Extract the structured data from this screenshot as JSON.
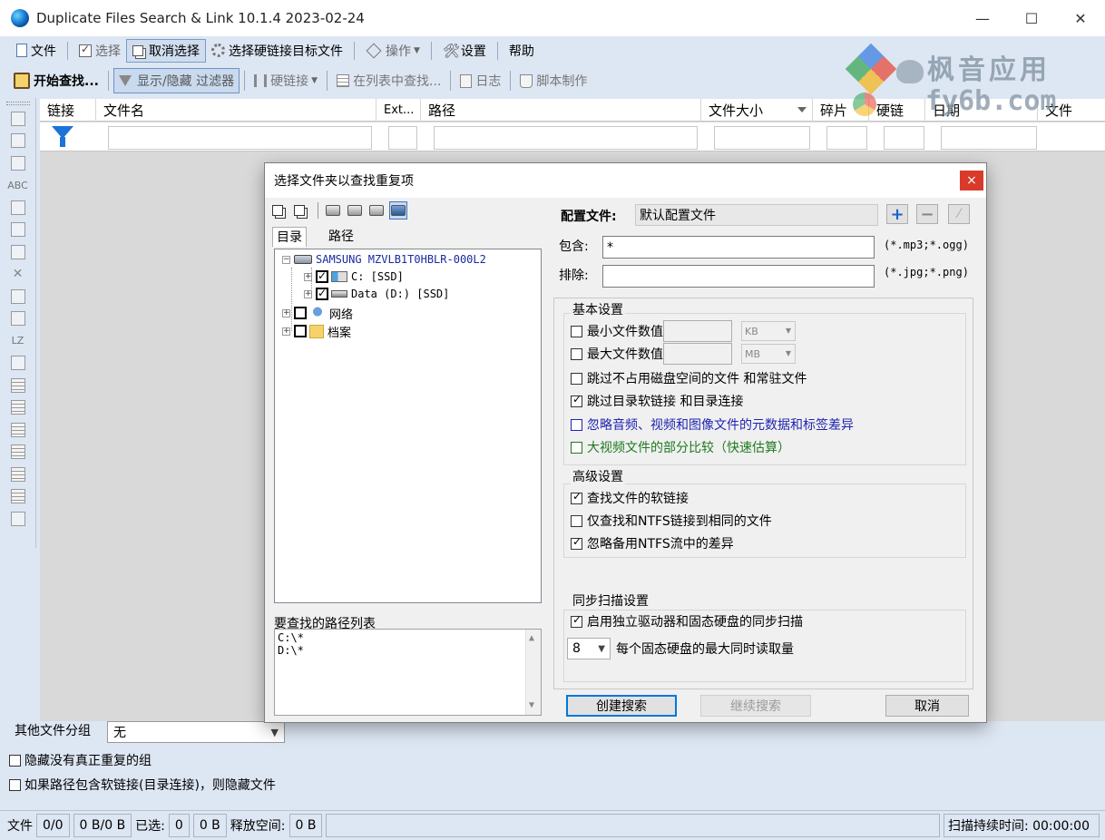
{
  "window": {
    "title": "Duplicate Files Search & Link 10.1.4 2023-02-24",
    "minimize": "—",
    "maximize": "☐",
    "close": "✕"
  },
  "menu": {
    "file": "文件",
    "select": "选择",
    "deselect": "取消选择",
    "select_hardlink_targets": "选择硬链接目标文件",
    "actions": "操作",
    "settings": "设置",
    "help": "帮助"
  },
  "toolbar": {
    "start_search": "开始查找...",
    "toggle_filter": "显示/隐藏 过滤器",
    "hardlink": "硬链接",
    "find_in_list": "在列表中查找...",
    "log": "日志",
    "script": "脚本制作"
  },
  "watermark": {
    "cn": "枫音应用",
    "en": "fy6b.com"
  },
  "grid": {
    "columns": [
      "链接",
      "文件名",
      "Ext...",
      "路径",
      "文件大小",
      "碎片",
      "硬链",
      "日期",
      "文件"
    ]
  },
  "left_column": {
    "lz_label": "LZ",
    "abc_label": "ABC"
  },
  "bottom": {
    "group_label": "其他文件分组",
    "group_value": "无",
    "hide_groups": "隐藏没有真正重复的组",
    "hide_symlink_files": "如果路径包含软链接(目录连接)，则隐藏文件"
  },
  "statusbar": {
    "files_label": "文件",
    "files_count": "0/0",
    "files_size": "0 B/0 B",
    "selected_label": "已选:",
    "selected_count": "0",
    "selected_size": "0 B",
    "free_label": "释放空间:",
    "free_value": "0 B",
    "scan_duration": "扫描持续时间: 00:00:00"
  },
  "dialog": {
    "title": "选择文件夹以查找重复项",
    "close": "×",
    "tabs": [
      "目录",
      "路径"
    ],
    "tree": {
      "disk": "SAMSUNG MZVLB1T0HBLR-000L2",
      "c_drive": "C: [SSD]",
      "d_drive": "Data (D:) [SSD]",
      "network": "网络",
      "archive": "档案"
    },
    "path_list_label": "要查找的路径列表",
    "path_list": [
      "C:\\*",
      "D:\\*"
    ],
    "profile_label": "配置文件:",
    "profile_value": "默认配置文件",
    "include_label": "包含:",
    "include_value": "*",
    "include_hint": "(*.mp3;*.ogg)",
    "exclude_label": "排除:",
    "exclude_value": "",
    "exclude_hint": "(*.jpg;*.png)",
    "basic": {
      "title": "基本设置",
      "min_size": "最小文件数值",
      "max_size": "最大文件数值",
      "min_unit": "KB",
      "max_unit": "MB",
      "skip_unused": "跳过不占用磁盘空间的文件 和常驻文件",
      "skip_symlinks": "跳过目录软链接 和目录连接",
      "ignore_metadata": "忽略音频、视频和图像文件的元数据和标签差异",
      "partial_compare": "大视频文件的部分比较（快速估算）"
    },
    "advanced": {
      "title": "高级设置",
      "find_symlinks": "查找文件的软链接",
      "ntfs_same": "仅查找和NTFS链接到相同的文件",
      "ignore_ntfs_streams": "忽略备用NTFS流中的差异"
    },
    "sync": {
      "title": "同步扫描设置",
      "enable_sync": "启用独立驱动器和固态硬盘的同步扫描",
      "max_reads_value": "8",
      "max_reads_label": "每个固态硬盘的最大同时读取量"
    },
    "buttons": {
      "create": "创建搜索",
      "continue": "继续搜索",
      "cancel": "取消"
    }
  }
}
